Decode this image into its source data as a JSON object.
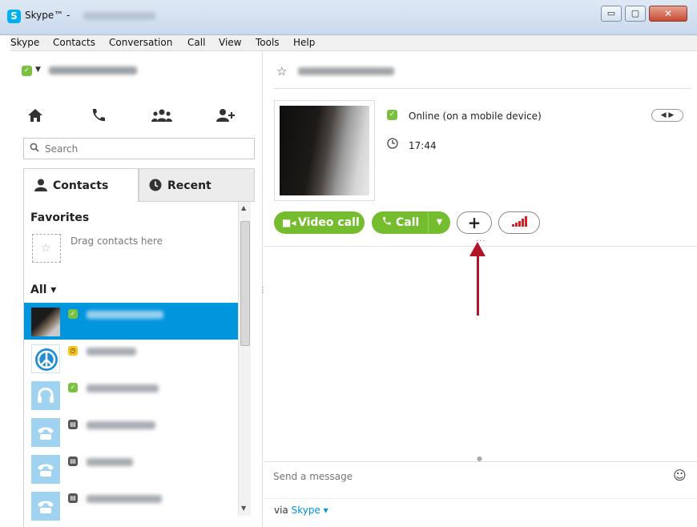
{
  "window": {
    "app_icon": "S",
    "title": "Skype™ -",
    "minimize": "▭",
    "maximize": "▢",
    "close": "✕"
  },
  "menu": [
    "Skype",
    "Contacts",
    "Conversation",
    "Call",
    "View",
    "Tools",
    "Help"
  ],
  "nav_icons": [
    "home-icon",
    "phone-icon",
    "group-icon",
    "add-contact-icon"
  ],
  "search": {
    "placeholder": "Search"
  },
  "tabs": {
    "contacts": "Contacts",
    "recent": "Recent"
  },
  "favorites": {
    "title": "Favorites",
    "hint": "Drag contacts here"
  },
  "all_label": "All ▾",
  "conversation": {
    "status_text": "Online (on a mobile device)",
    "local_time": "17:44",
    "video_call": "Video call",
    "call": "Call",
    "add": "+",
    "message_placeholder": "Send a message",
    "via": "via",
    "via_link": "Skype ▾"
  },
  "colors": {
    "accent": "#0095dd",
    "green": "#75bc2f",
    "online": "#7ac142",
    "away": "#f8c41b",
    "arrow": "#b2152a"
  }
}
